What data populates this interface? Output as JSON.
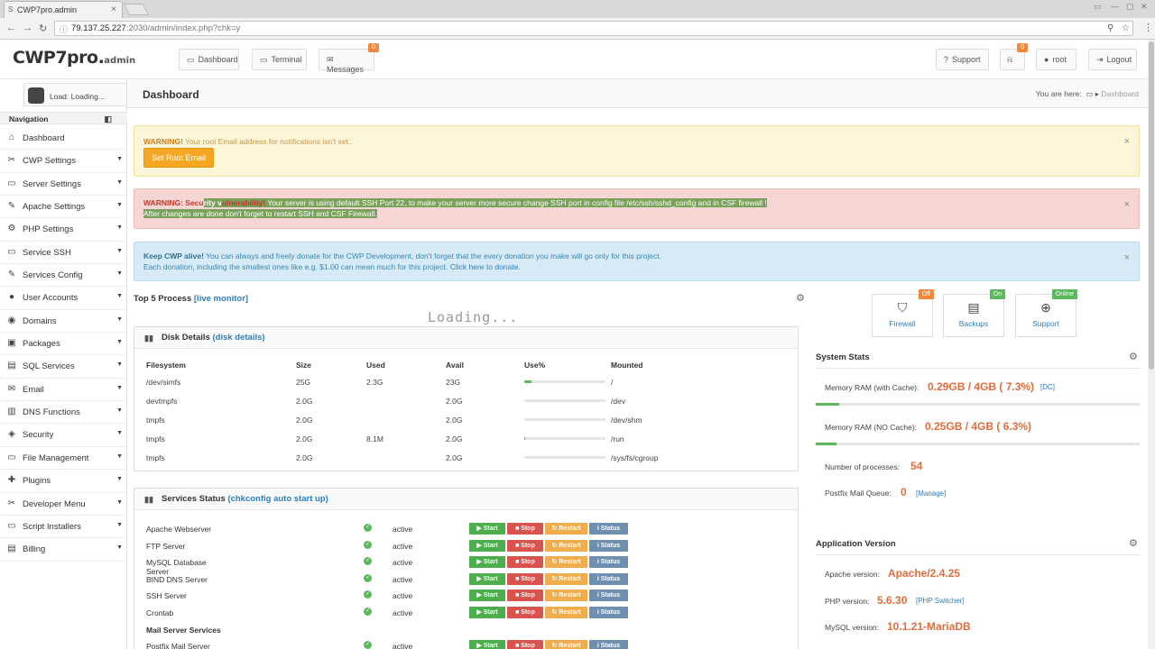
{
  "browser": {
    "tab_title": "CWP7pro.admin",
    "tab_icon": "S",
    "url_host": "79.137.25.227",
    "url_rest": ":2030/admin/index.php?chk=y"
  },
  "header": {
    "logo_main": "CWP7pro.",
    "logo_suffix": "admin",
    "nav": {
      "dashboard": "Dashboard",
      "terminal": "Terminal",
      "messages": "Messages",
      "messages_count": "0"
    },
    "support": "Support",
    "notif_count": "0",
    "user": "root",
    "logout": "Logout"
  },
  "sidebar": {
    "load": "Load: Loading...",
    "nav_title": "Navigation",
    "items": [
      {
        "label": "Dashboard",
        "icon": "⌂",
        "caret": ""
      },
      {
        "label": "CWP Settings",
        "icon": "✂",
        "caret": "▼"
      },
      {
        "label": "Server Settings",
        "icon": "▭",
        "caret": "▼"
      },
      {
        "label": "Apache Settings",
        "icon": "✎",
        "caret": "▼"
      },
      {
        "label": "PHP Settings",
        "icon": "⚙",
        "caret": "▼"
      },
      {
        "label": "Service SSH",
        "icon": "▭",
        "caret": "▼"
      },
      {
        "label": "Services Config",
        "icon": "✎",
        "caret": "▼"
      },
      {
        "label": "User Accounts",
        "icon": "●",
        "caret": "▼"
      },
      {
        "label": "Domains",
        "icon": "◉",
        "caret": "▼"
      },
      {
        "label": "Packages",
        "icon": "▣",
        "caret": "▼"
      },
      {
        "label": "SQL Services",
        "icon": "▤",
        "caret": "▼"
      },
      {
        "label": "Email",
        "icon": "✉",
        "caret": "▼"
      },
      {
        "label": "DNS Functions",
        "icon": "▥",
        "caret": "▼"
      },
      {
        "label": "Security",
        "icon": "◈",
        "caret": "▼"
      },
      {
        "label": "File Management",
        "icon": "▭",
        "caret": "▼"
      },
      {
        "label": "Plugins",
        "icon": "✚",
        "caret": "▼"
      },
      {
        "label": "Developer Menu",
        "icon": "✂",
        "caret": "▼"
      },
      {
        "label": "Script Installers",
        "icon": "▭",
        "caret": "▼"
      },
      {
        "label": "Billing",
        "icon": "▤",
        "caret": "▼"
      }
    ]
  },
  "page": {
    "title": "Dashboard",
    "breadcrumb_prefix": "You are here:",
    "breadcrumb_current": "Dashboard"
  },
  "alerts": {
    "warning": {
      "label": "WARNING!",
      "text": " Your root Email address for notifications isn't set..",
      "button": "Set Root Email"
    },
    "security": {
      "label_a": "WARNING: Secu",
      "label_b": "rity v",
      "label_c": "ulnerability!",
      "line1": " Your server is using default SSH Port 22, to make your server more secure change SSH port in config file /etc/ssh/sshd_config and in CSF firewall !",
      "line2": "After changes are done don't forget to restart SSH and CSF Firewall."
    },
    "donate": {
      "label": "Keep CWP alive!",
      "line1": " You can always and freely donate for the CWP Development, don't forget that the every donation you make will go only for this project.",
      "line2": "Each donation, including the smallest ones like e.g. $1.00 can mean much for this project. ",
      "link": "Click here to donate."
    }
  },
  "top5": {
    "title": "Top 5 Process ",
    "link": "[live monitor]",
    "loading": "Loading..."
  },
  "disk": {
    "title": "Disk Details ",
    "link": "(disk details)",
    "headers": [
      "Filesystem",
      "Size",
      "Used",
      "Avail",
      "Use%",
      "Mounted"
    ],
    "rows": [
      {
        "fs": "/dev/simfs",
        "size": "25G",
        "used": "2.3G",
        "avail": "23G",
        "use_pct": 9,
        "mount": "/"
      },
      {
        "fs": "devtmpfs",
        "size": "2.0G",
        "used": "",
        "avail": "2.0G",
        "use_pct": 0,
        "mount": "/dev"
      },
      {
        "fs": "tmpfs",
        "size": "2.0G",
        "used": "",
        "avail": "2.0G",
        "use_pct": 0,
        "mount": "/dev/shm"
      },
      {
        "fs": "tmpfs",
        "size": "2.0G",
        "used": "8.1M",
        "avail": "2.0G",
        "use_pct": 1,
        "mount": "/run"
      },
      {
        "fs": "tmpfs",
        "size": "2.0G",
        "used": "",
        "avail": "2.0G",
        "use_pct": 0,
        "mount": "/sys/fs/cgroup"
      }
    ]
  },
  "services": {
    "title": "Services Status ",
    "link": "(chkconfig auto start up)",
    "rows": [
      {
        "name": "Apache Webserver",
        "state": "active"
      },
      {
        "name": "FTP Server",
        "state": "active"
      },
      {
        "name": "MySQL Database Server",
        "state": "active"
      },
      {
        "name": "BIND DNS Server",
        "state": "active"
      },
      {
        "name": "SSH Server",
        "state": "active"
      },
      {
        "name": "Crontab",
        "state": "active"
      }
    ],
    "mail_heading": "Mail Server Services",
    "mail_rows": [
      {
        "name": "Postfix Mail Server",
        "state": "active"
      }
    ],
    "buttons": {
      "start": "▶ Start",
      "stop": "■ Stop",
      "restart": "↻ Restart",
      "status": "i Status"
    }
  },
  "quick": [
    {
      "label": "Firewall",
      "badge": "Off",
      "badge_color": "#f0883e",
      "icon": "⛉"
    },
    {
      "label": "Backups",
      "badge": "On",
      "badge_color": "#5cb85c",
      "icon": "▤"
    },
    {
      "label": "Support",
      "badge": "Online",
      "badge_color": "#5cb85c",
      "icon": "⊕"
    }
  ],
  "system_stats": {
    "title": "System Stats",
    "ram_cache_label": "Memory RAM (with Cache):",
    "ram_cache_value": "0.29GB / 4GB ( 7.3%)",
    "ram_cache_pct": 7.3,
    "ram_cache_link": "[DC]",
    "ram_nocache_label": "Memory RAM (NO Cache):",
    "ram_nocache_value": "0.25GB / 4GB ( 6.3%)",
    "ram_nocache_pct": 6.3,
    "processes_label": "Number of processes:",
    "processes_value": "54",
    "mailq_label": "Postfix Mail Queue:",
    "mailq_value": "0",
    "mailq_link": "[Manage]"
  },
  "app_version": {
    "title": "Application Version",
    "apache_label": "Apache version:",
    "apache_value": "Apache/2.4.25",
    "php_label": "PHP version:",
    "php_value": "5.6.30",
    "php_link": "[PHP Switcher]",
    "mysql_label": "MySQL version:",
    "mysql_value": "10.1.21-MariaDB"
  }
}
